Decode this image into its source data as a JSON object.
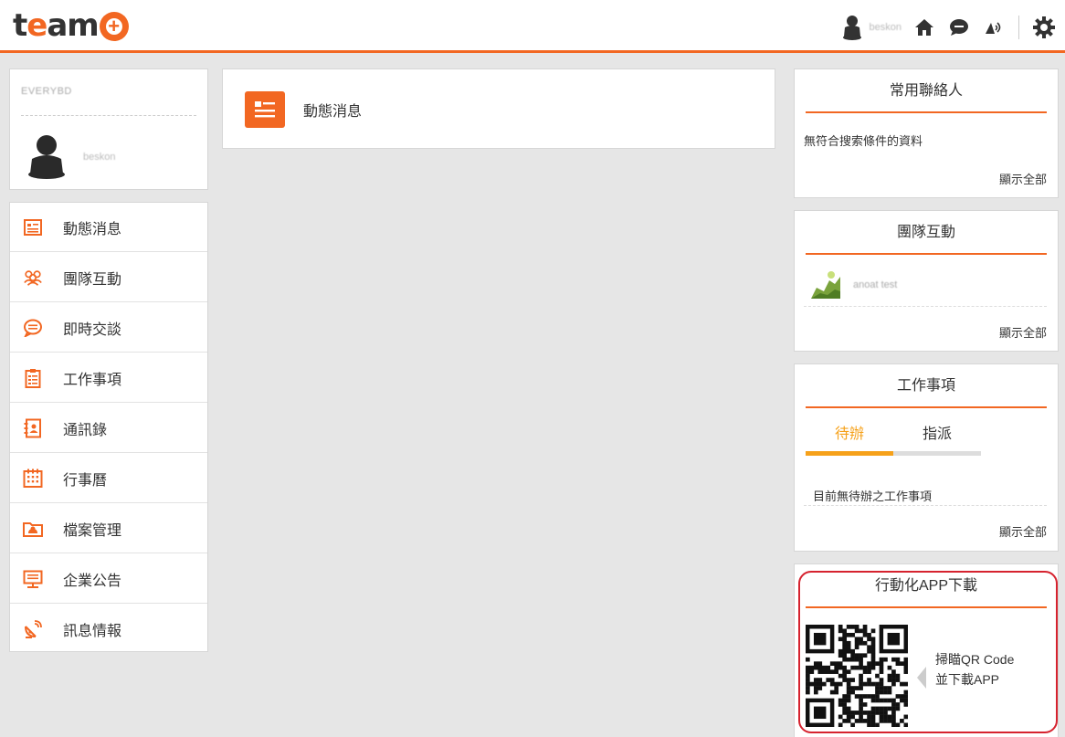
{
  "brand": {
    "logo_text_t": "t",
    "logo_text_e": "e",
    "logo_text_am": "am",
    "accent": "#f26722"
  },
  "header": {
    "user_name": "beskon"
  },
  "profile": {
    "company": "EVERYBD",
    "user_name": "beskon"
  },
  "nav": {
    "items": [
      {
        "label": "動態消息",
        "icon": "news-icon"
      },
      {
        "label": "團隊互動",
        "icon": "team-icon"
      },
      {
        "label": "即時交談",
        "icon": "chat-icon"
      },
      {
        "label": "工作事項",
        "icon": "clipboard-icon"
      },
      {
        "label": "通訊錄",
        "icon": "contacts-icon"
      },
      {
        "label": "行事曆",
        "icon": "calendar-icon"
      },
      {
        "label": "檔案管理",
        "icon": "folder-icon"
      },
      {
        "label": "企業公告",
        "icon": "announcement-icon"
      },
      {
        "label": "訊息情報",
        "icon": "satellite-icon"
      }
    ]
  },
  "feed": {
    "title": "動態消息"
  },
  "contacts_widget": {
    "title": "常用聯絡人",
    "empty_text": "無符合搜索條件的資料",
    "show_all": "顯示全部"
  },
  "team_widget": {
    "title": "團隊互動",
    "item_name": "anoat test",
    "show_all": "顯示全部"
  },
  "tasks_widget": {
    "title": "工作事項",
    "tabs": [
      {
        "label": "待辦",
        "active": true
      },
      {
        "label": "指派",
        "active": false
      }
    ],
    "empty_text": "目前無待辦之工作事項",
    "show_all": "顯示全部"
  },
  "app_widget": {
    "title": "行動化APP下載",
    "scan_line1": "掃瞄QR Code",
    "scan_line2": "並下載APP"
  }
}
